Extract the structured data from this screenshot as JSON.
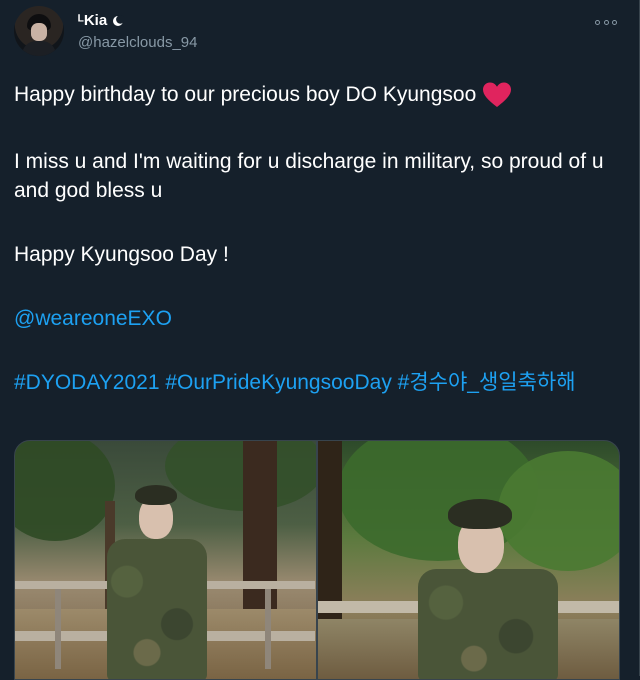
{
  "user": {
    "display_name": "ᴸKia",
    "handle": "@hazelclouds_94"
  },
  "tweet": {
    "line1": "Happy birthday to our precious boy DO Kyungsoo",
    "line2": "I miss u and I'm waiting for u discharge in military, so proud of u and god bless u",
    "line3": "Happy Kyungsoo Day !",
    "mention": "@weareoneEXO",
    "hashtags": "#DYODAY2021 #OurPrideKyungsooDay #경수야_생일축하해"
  },
  "icons": {
    "moon": "crescent-moon-icon",
    "heart": "red-heart-emoji",
    "more": "more-options-icon"
  },
  "colors": {
    "background": "#15202b",
    "link": "#1da1f2",
    "secondary_text": "#8899a6",
    "heart": "#e0245e"
  }
}
